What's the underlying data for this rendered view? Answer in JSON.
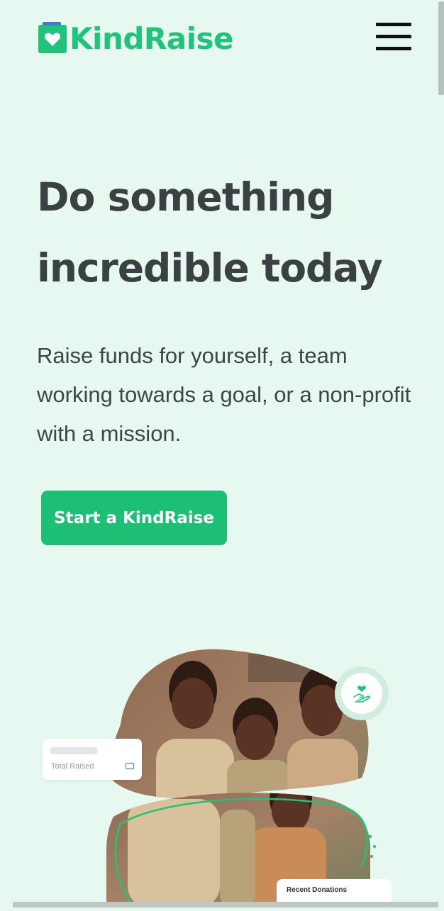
{
  "header": {
    "logo_text": "KindRaise",
    "menu_icon": "hamburger-menu-icon",
    "brand_color": "#1fc37a"
  },
  "hero": {
    "title_line1": "Do something",
    "title_line2": "incredible today",
    "subtitle": "Raise funds for yourself, a team working towards a goal, or a non-profit with a mission.",
    "cta_label": "Start a KindRaise",
    "cta_color": "#1cbf73"
  },
  "illustration": {
    "total_raised_label": "Total Raised",
    "recent_donations_label": "Recent Donations",
    "badge_icon": "heart-in-hand-icon"
  }
}
